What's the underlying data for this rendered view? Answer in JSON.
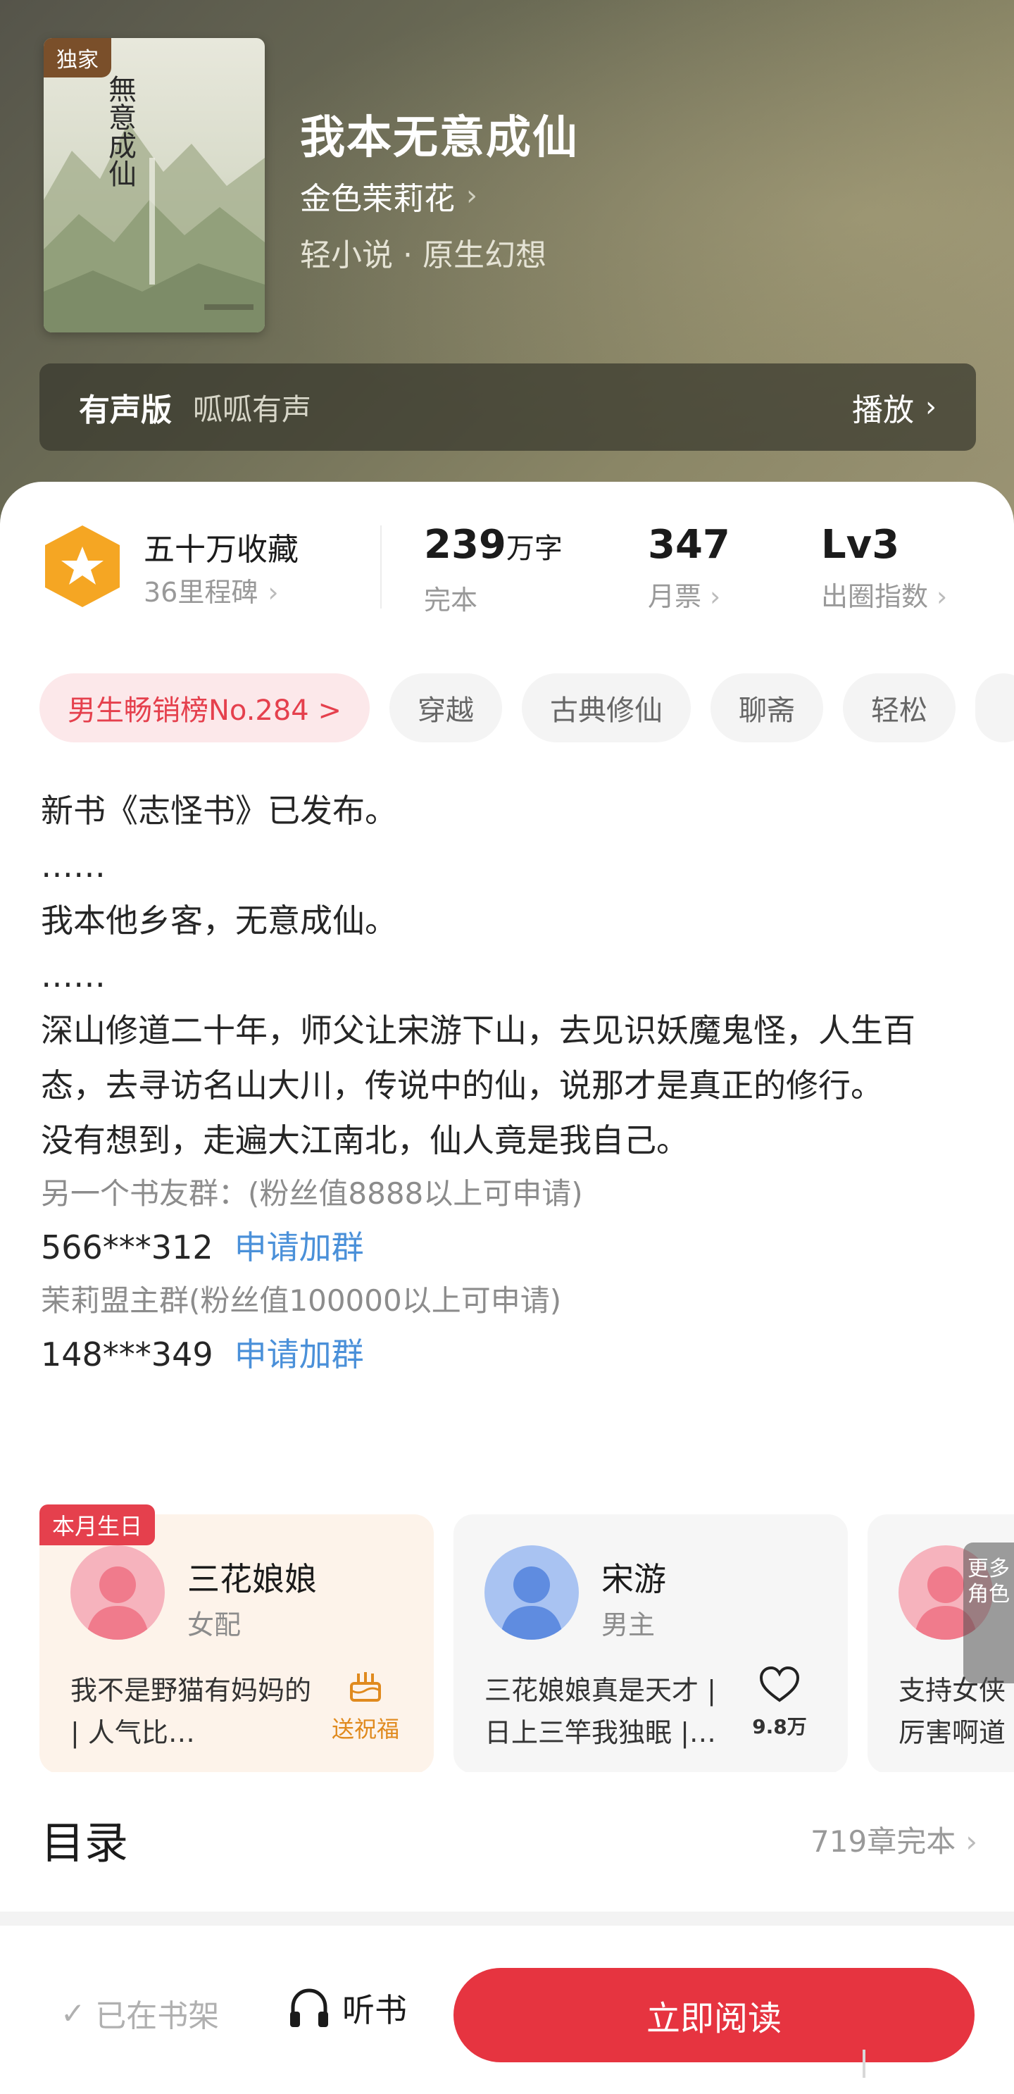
{
  "book": {
    "badge": "独家",
    "cover_title": "無意成仙",
    "title": "我本无意成仙",
    "author": "金色茉莉花",
    "genre": "轻小说 · 原生幻想"
  },
  "audio": {
    "label": "有声版",
    "source": "呱呱有声",
    "action": "播放"
  },
  "stats": {
    "favorites": "五十万收藏",
    "milestones": "36里程碑",
    "words_value": "239",
    "words_unit": "万字",
    "words_label": "完本",
    "tickets_value": "347",
    "tickets_label": "月票",
    "level_value": "Lv3",
    "level_label": "出圈指数"
  },
  "tags": [
    "男生畅销榜No.284 >",
    "穿越",
    "古典修仙",
    "聊斋",
    "轻松"
  ],
  "description": {
    "lines": [
      "新书《志怪书》已发布。",
      "……",
      "我本他乡客，无意成仙。",
      "……",
      "深山修道二十年，师父让宋游下山，去见识妖魔鬼怪，人生百态，去寻访名山大川，传说中的仙，说那才是真正的修行。",
      "没有想到，走遍大江南北，仙人竟是我自己。"
    ],
    "group1_label": "另一个书友群：(粉丝值8888以上可申请)",
    "group1_number": "566***312",
    "group2_label": "茉莉盟主群(粉丝值100000以上可申请)",
    "group2_number": "148***349",
    "join_label": "申请加群"
  },
  "characters": [
    {
      "badge": "本月生日",
      "name": "三花娘娘",
      "role": "女配",
      "quote": "我不是野猫有妈妈的 | 人气比…",
      "action": "送祝福"
    },
    {
      "name": "宋游",
      "role": "男主",
      "quote": "三花娘娘真是天才 | 日上三竿我独眠 |…",
      "likes": "9.8万"
    },
    {
      "quote": "支持女侠 厉害啊道"
    }
  ],
  "more_roles": "更多角色",
  "toc": {
    "title": "目录",
    "info": "719章完本"
  },
  "bottom_bar": {
    "shelf": "已在书架",
    "listen": "听书",
    "read": "立即阅读"
  },
  "colors": {
    "accent_red": "#e63440",
    "link_blue": "#4a90d9",
    "badge_gold": "#f5a623"
  }
}
